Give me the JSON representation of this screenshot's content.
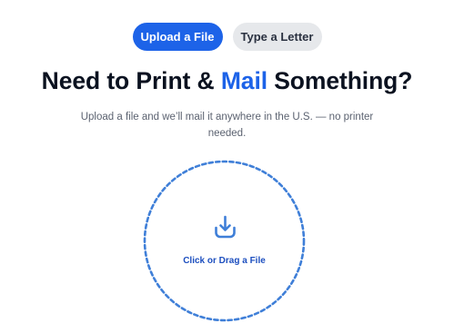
{
  "tabs": {
    "upload_label": "Upload a File",
    "letter_label": "Type a Letter",
    "active": "upload"
  },
  "headline": {
    "before": "Need to Print & ",
    "accent": "Mail",
    "after": " Something?"
  },
  "subtitle": "Upload a file and we’ll mail it anywhere in the U.S. — no printer needed.",
  "dropzone": {
    "label": "Click or Drag a File",
    "icon": "download-tray-icon"
  },
  "colors": {
    "accent": "#1d63e8",
    "tab_inactive": "#e6e8eb",
    "heading": "#0b1220",
    "muted_text": "#5b6270",
    "dropzone_border": "#3f7fd8",
    "dropzone_label": "#1d4fbf"
  }
}
